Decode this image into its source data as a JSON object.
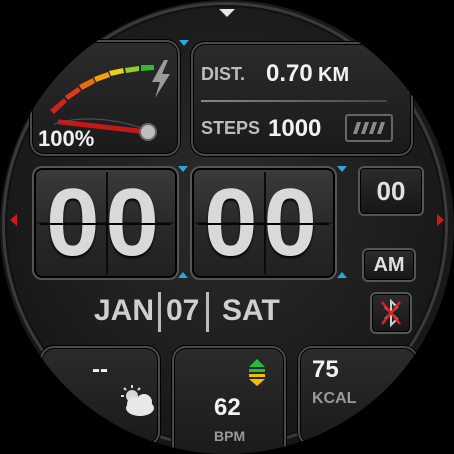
{
  "battery": {
    "percent_label": "100%",
    "level": 1.0
  },
  "distance": {
    "label": "DIST.",
    "value": "0.70",
    "unit": "KM"
  },
  "steps": {
    "label": "STEPS",
    "value": "1000"
  },
  "time": {
    "hours": "00",
    "minutes": "00",
    "seconds": "00",
    "ampm": "AM"
  },
  "date": {
    "month": "JAN",
    "day": "07",
    "weekday": "SAT"
  },
  "weather": {
    "temp": "--"
  },
  "heart": {
    "value": "62",
    "unit": "BPM"
  },
  "calories": {
    "value": "75",
    "unit": "KCAL"
  },
  "colors": {
    "accent_blue": "#29a8e0",
    "marker_red": "#d01818",
    "heart_green": "#22c040",
    "heart_yellow": "#f0c000"
  },
  "icons": [
    "lightning-icon",
    "battery-icon",
    "bluetooth-icon",
    "weather-cloud-sun-icon",
    "heart-rate-arrows-icon"
  ]
}
